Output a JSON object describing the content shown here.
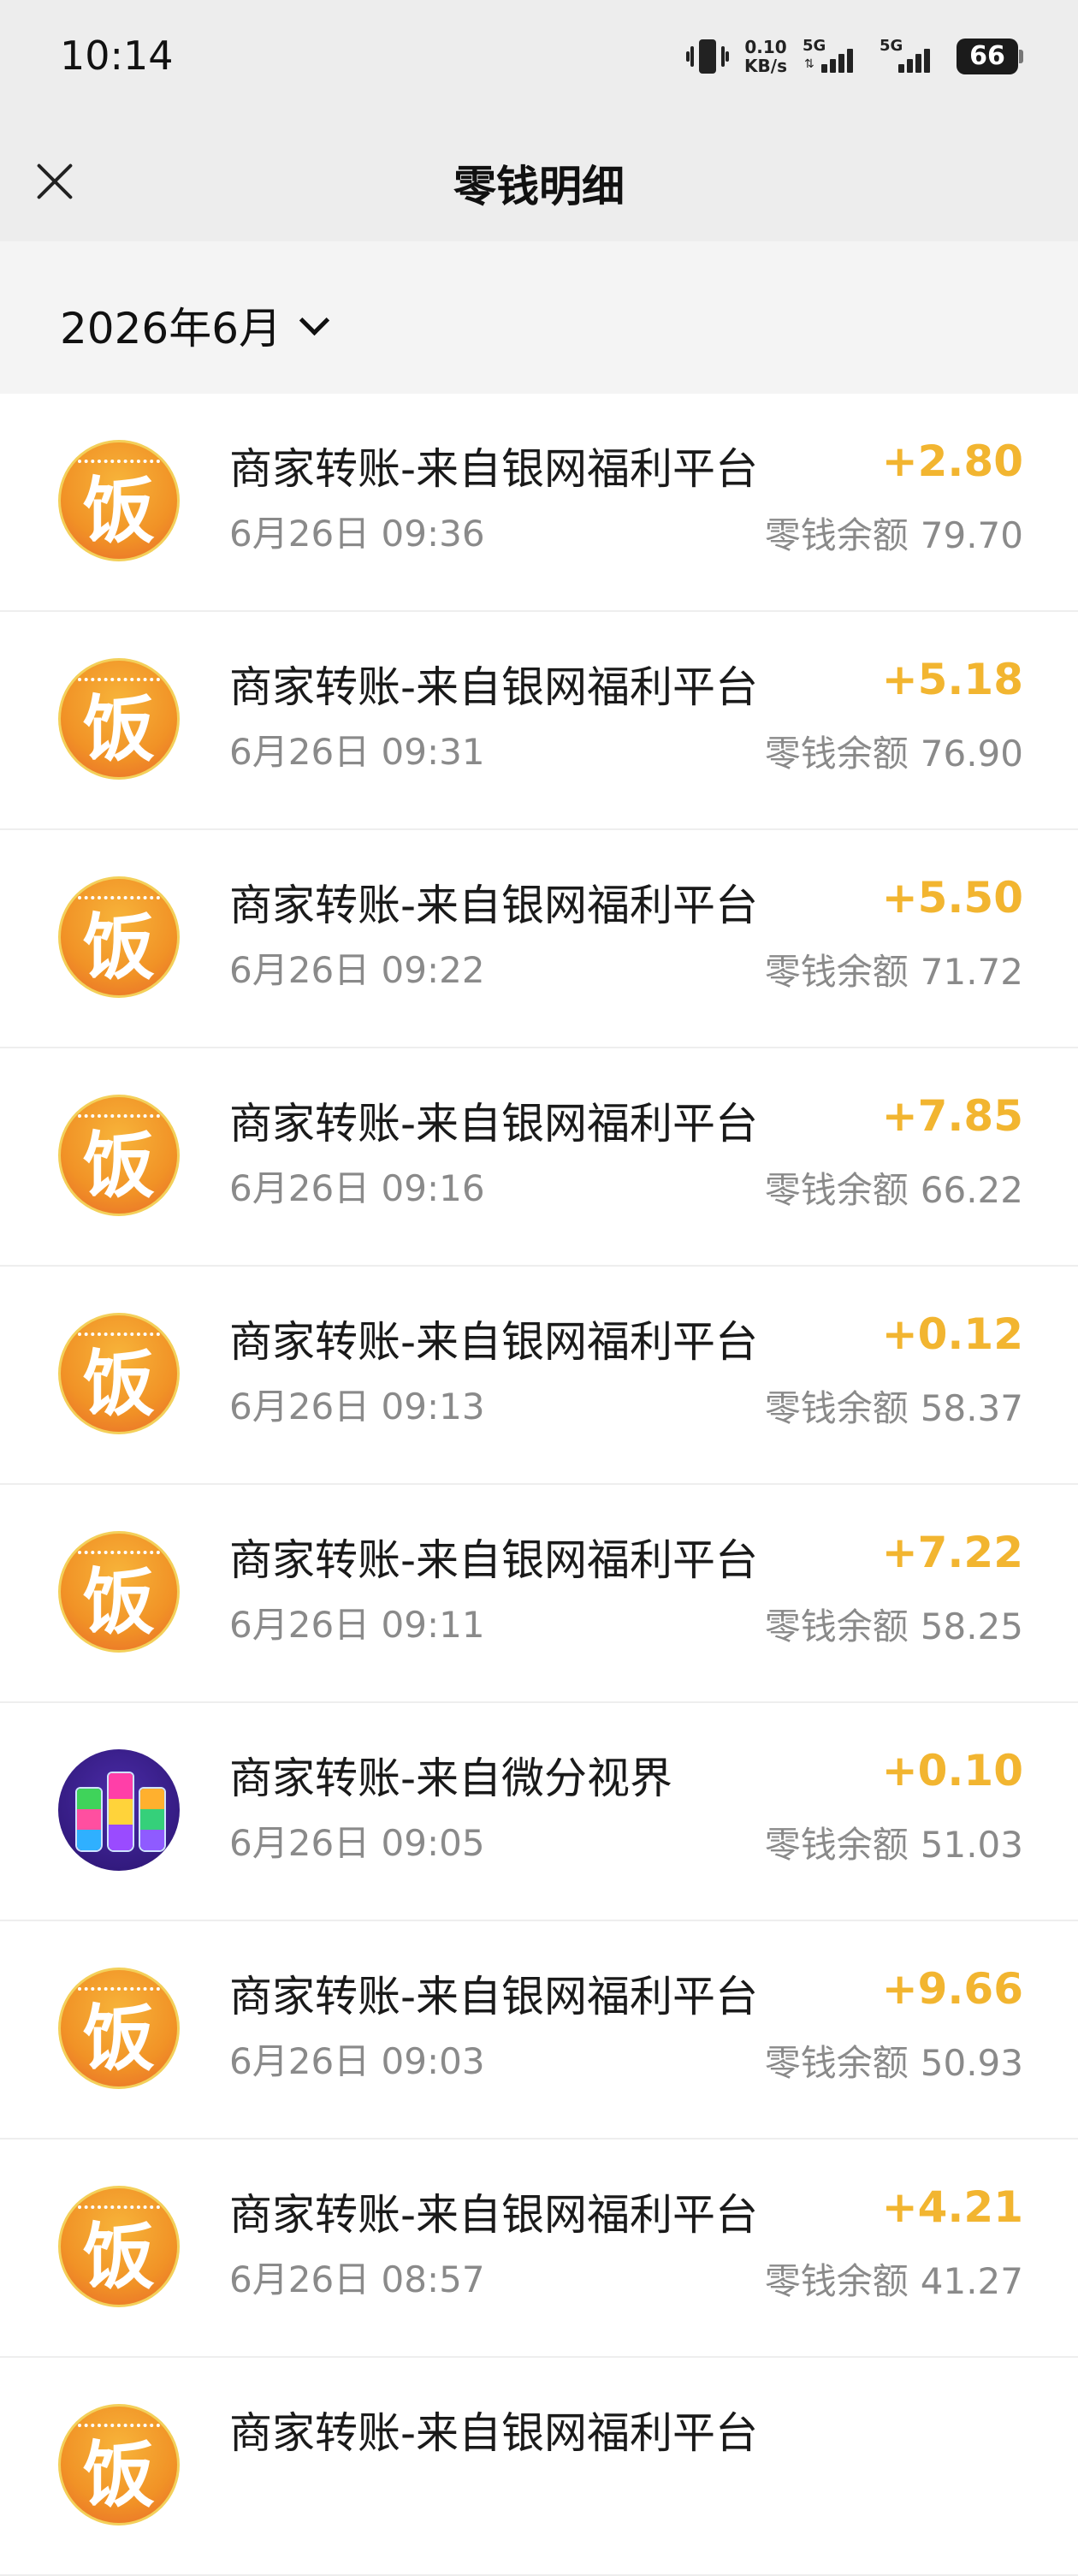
{
  "status": {
    "time": "10:14",
    "net_speed": "0.10",
    "net_unit": "KB/s",
    "sim1": "5G",
    "sim2": "5G",
    "battery": "66"
  },
  "header": {
    "title": "零钱明细",
    "close_icon": "close-icon"
  },
  "month_filter": {
    "label": "2026年6月",
    "icon": "chevron-down-icon"
  },
  "balance_label": "零钱余额",
  "transactions": [
    {
      "avatar": "fan",
      "title": "商家转账-来自银网福利平台",
      "time": "6月26日 09:36",
      "amount": "+2.80",
      "balance": "79.70"
    },
    {
      "avatar": "fan",
      "title": "商家转账-来自银网福利平台",
      "time": "6月26日 09:31",
      "amount": "+5.18",
      "balance": "76.90"
    },
    {
      "avatar": "fan",
      "title": "商家转账-来自银网福利平台",
      "time": "6月26日 09:22",
      "amount": "+5.50",
      "balance": "71.72"
    },
    {
      "avatar": "fan",
      "title": "商家转账-来自银网福利平台",
      "time": "6月26日 09:16",
      "amount": "+7.85",
      "balance": "66.22"
    },
    {
      "avatar": "fan",
      "title": "商家转账-来自银网福利平台",
      "time": "6月26日 09:13",
      "amount": "+0.12",
      "balance": "58.37"
    },
    {
      "avatar": "fan",
      "title": "商家转账-来自银网福利平台",
      "time": "6月26日 09:11",
      "amount": "+7.22",
      "balance": "58.25"
    },
    {
      "avatar": "bottles",
      "title": "商家转账-来自微分视界",
      "time": "6月26日 09:05",
      "amount": "+0.10",
      "balance": "51.03"
    },
    {
      "avatar": "fan",
      "title": "商家转账-来自银网福利平台",
      "time": "6月26日 09:03",
      "amount": "+9.66",
      "balance": "50.93"
    },
    {
      "avatar": "fan",
      "title": "商家转账-来自银网福利平台",
      "time": "6月26日 08:57",
      "amount": "+4.21",
      "balance": "41.27"
    },
    {
      "avatar": "fan",
      "title": "商家转账-来自银网福利平台",
      "time": "",
      "amount": "",
      "balance": ""
    }
  ],
  "fan_glyph": "饭",
  "colors": {
    "amount": "#f2b530",
    "header_bg": "#ededed",
    "month_bg": "#f4f4f4"
  }
}
